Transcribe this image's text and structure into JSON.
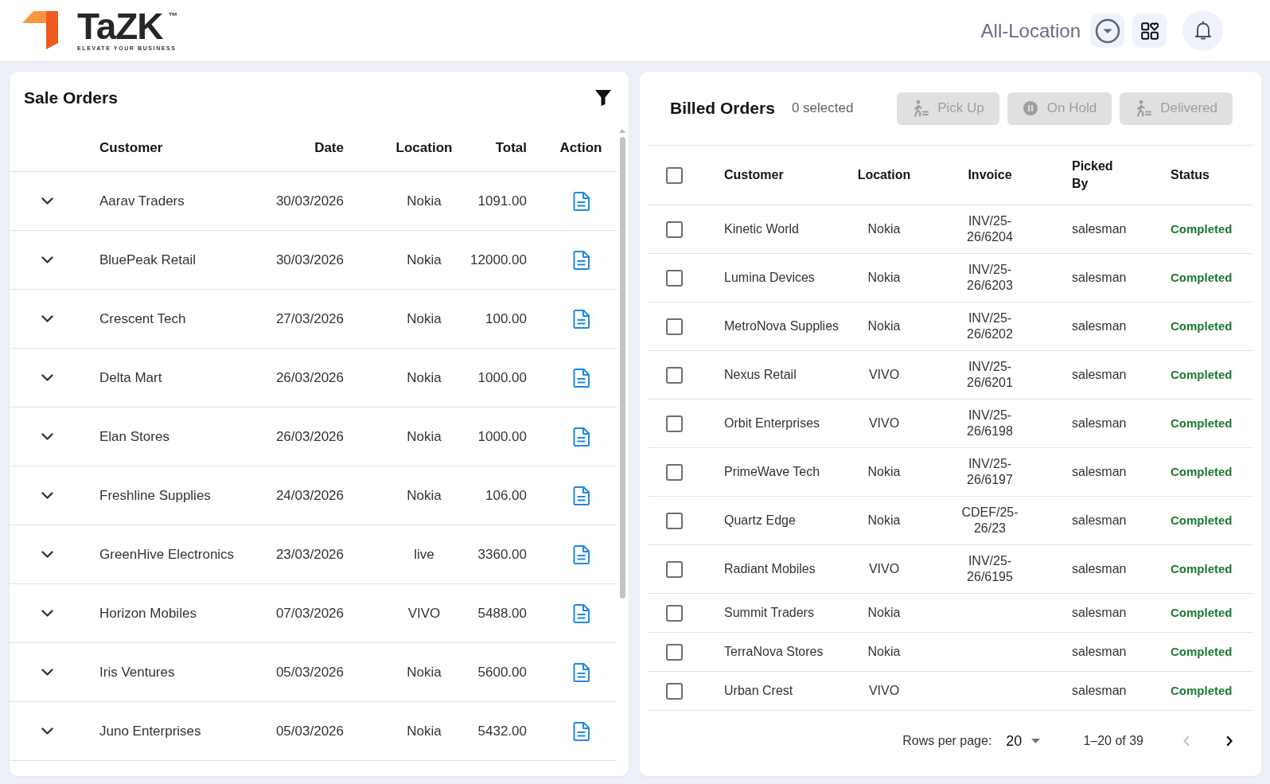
{
  "header": {
    "logo": {
      "wordmark": "TaZK",
      "trademark": "™",
      "tagline": "ELEVATE YOUR BUSINESS"
    },
    "location_selector": {
      "value": "All-Location"
    }
  },
  "sale_orders": {
    "title": "Sale Orders",
    "columns": [
      "Customer",
      "Date",
      "Location",
      "Total",
      "Action"
    ],
    "rows": [
      {
        "customer": "Aarav Traders",
        "date": "30/03/2026",
        "location": "Nokia",
        "total": "1091.00",
        "expanded": false
      },
      {
        "customer": "BluePeak Retail",
        "date": "30/03/2026",
        "location": "Nokia",
        "total": "12000.00",
        "expanded": false
      },
      {
        "customer": "Crescent Tech",
        "date": "27/03/2026",
        "location": "Nokia",
        "total": "100.00",
        "expanded": false
      },
      {
        "customer": "Delta Mart",
        "date": "26/03/2026",
        "location": "Nokia",
        "total": "1000.00",
        "expanded": false
      },
      {
        "customer": "Elan Stores",
        "date": "26/03/2026",
        "location": "Nokia",
        "total": "1000.00",
        "expanded": false
      },
      {
        "customer": "Freshline Supplies",
        "date": "24/03/2026",
        "location": "Nokia",
        "total": "106.00",
        "expanded": false
      },
      {
        "customer": "GreenHive Electronics",
        "date": "23/03/2026",
        "location": "live",
        "total": "3360.00",
        "expanded": false
      },
      {
        "customer": "Horizon Mobiles",
        "date": "07/03/2026",
        "location": "VIVO",
        "total": "5488.00",
        "expanded": false
      },
      {
        "customer": "Iris Ventures",
        "date": "05/03/2026",
        "location": "Nokia",
        "total": "5600.00",
        "expanded": false
      },
      {
        "customer": "Juno Enterprises",
        "date": "05/03/2026",
        "location": "Nokia",
        "total": "5432.00",
        "expanded": false
      }
    ]
  },
  "billed_orders": {
    "title": "Billed Orders",
    "selected_count": "0 selected",
    "actions": [
      {
        "kind": "pickup",
        "label": "Pick Up",
        "disabled": true
      },
      {
        "kind": "hold",
        "label": "On Hold",
        "disabled": true
      },
      {
        "kind": "deliver",
        "label": "Delivered",
        "disabled": true
      }
    ],
    "select_all": {
      "checked": false
    },
    "columns": [
      "Customer",
      "Location",
      "Invoice",
      "Picked By",
      "Status"
    ],
    "rows": [
      {
        "customer": "Kinetic World",
        "location": "Nokia",
        "invoice": "INV/25-26/6204",
        "picked_by": "salesman",
        "status": "Completed",
        "checked": false
      },
      {
        "customer": "Lumina Devices",
        "location": "Nokia",
        "invoice": "INV/25-26/6203",
        "picked_by": "salesman",
        "status": "Completed",
        "checked": false
      },
      {
        "customer": "MetroNova Supplies",
        "location": "Nokia",
        "invoice": "INV/25-26/6202",
        "picked_by": "salesman",
        "status": "Completed",
        "checked": false
      },
      {
        "customer": "Nexus Retail",
        "location": "VIVO",
        "invoice": "INV/25-26/6201",
        "picked_by": "salesman",
        "status": "Completed",
        "checked": false
      },
      {
        "customer": "Orbit Enterprises",
        "location": "VIVO",
        "invoice": "INV/25-26/6198",
        "picked_by": "salesman",
        "status": "Completed",
        "checked": false
      },
      {
        "customer": "PrimeWave Tech",
        "location": "Nokia",
        "invoice": "INV/25-26/6197",
        "picked_by": "salesman",
        "status": "Completed",
        "checked": false
      },
      {
        "customer": "Quartz Edge",
        "location": "Nokia",
        "invoice": "CDEF/25-26/23",
        "picked_by": "salesman",
        "status": "Completed",
        "checked": false
      },
      {
        "customer": "Radiant Mobiles",
        "location": "VIVO",
        "invoice": "INV/25-26/6195",
        "picked_by": "salesman",
        "status": "Completed",
        "checked": false
      },
      {
        "customer": "Summit Traders",
        "location": "Nokia",
        "picked_by": "salesman",
        "status": "Completed",
        "checked": false
      },
      {
        "customer": "TerraNova Stores",
        "location": "Nokia",
        "picked_by": "salesman",
        "status": "Completed",
        "checked": false
      },
      {
        "customer": "Urban Crest",
        "location": "VIVO",
        "picked_by": "salesman",
        "status": "Completed",
        "checked": false
      }
    ],
    "pagination": {
      "rows_per_page_label": "Rows per page:",
      "rows_per_page": "20",
      "range": "1–20 of 39",
      "previous": {
        "disabled": true
      },
      "next": {
        "disabled": false
      }
    }
  }
}
